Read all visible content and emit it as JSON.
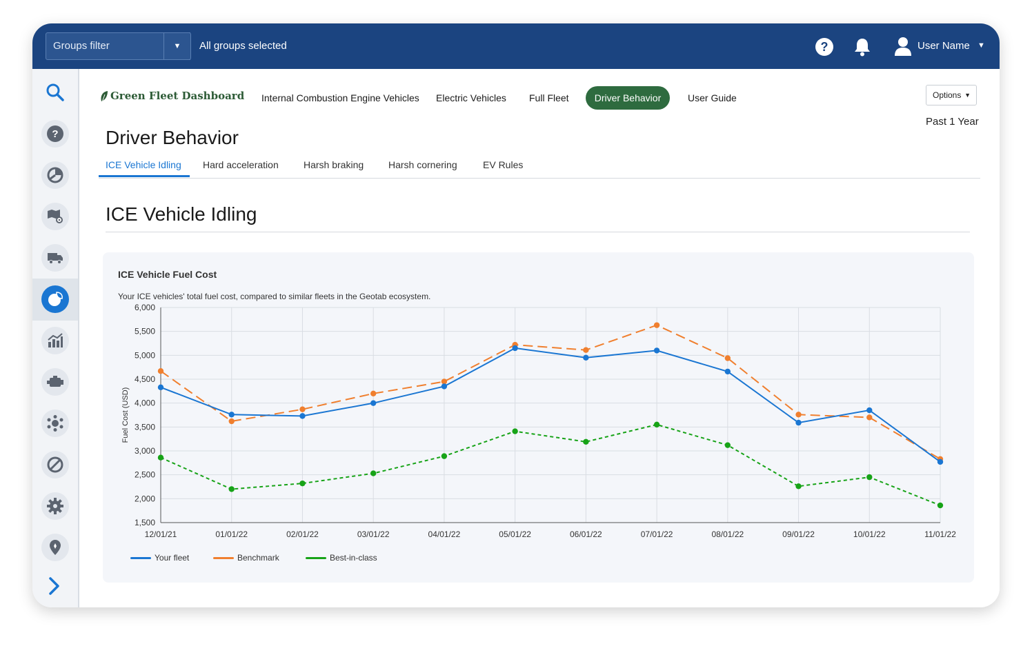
{
  "topbar": {
    "groups_filter_label": "Groups filter",
    "groups_status": "All groups selected",
    "help_label": "?",
    "user_name": "User Name",
    "brand_color": "#1b4480"
  },
  "sidebar": {
    "items": [
      {
        "name": "search-icon"
      },
      {
        "name": "help-icon"
      },
      {
        "name": "pie-chart-icon"
      },
      {
        "name": "map-icon"
      },
      {
        "name": "truck-icon"
      },
      {
        "name": "sustainability-icon",
        "active": true
      },
      {
        "name": "analytics-icon"
      },
      {
        "name": "engine-icon"
      },
      {
        "name": "network-icon"
      },
      {
        "name": "rules-icon"
      },
      {
        "name": "settings-icon"
      },
      {
        "name": "location-icon"
      },
      {
        "name": "expand-icon"
      }
    ]
  },
  "header": {
    "logo_text": "Green Fleet Dashboard",
    "nav": [
      {
        "label": "Internal Combustion Engine Vehicles"
      },
      {
        "label": "Electric Vehicles"
      },
      {
        "label": "Full Fleet"
      },
      {
        "label": "Driver Behavior",
        "active": true
      },
      {
        "label": "User Guide"
      }
    ],
    "options_label": "Options",
    "period": "Past 1 Year",
    "active_color": "#2e6b3f"
  },
  "page": {
    "title": "Driver Behavior",
    "tabs": [
      {
        "label": "ICE Vehicle Idling",
        "active": true
      },
      {
        "label": "Hard acceleration"
      },
      {
        "label": "Harsh braking"
      },
      {
        "label": "Harsh cornering"
      },
      {
        "label": "EV Rules"
      }
    ],
    "section_title": "ICE Vehicle Idling"
  },
  "chart_data": {
    "type": "line",
    "title": "ICE Vehicle Fuel Cost",
    "subtitle": "Your ICE vehicles' total fuel cost, compared to similar fleets in the Geotab ecosystem.",
    "xlabel": "",
    "ylabel": "Fuel Cost (USD)",
    "ylim": [
      1500,
      6000
    ],
    "yticks": [
      1500,
      2000,
      2500,
      3000,
      3500,
      4000,
      4500,
      5000,
      5500,
      6000
    ],
    "ytick_labels": [
      "1,500",
      "2,000",
      "2,500",
      "3,000",
      "3,500",
      "4,000",
      "4,500",
      "5,000",
      "5,500",
      "6,000"
    ],
    "categories": [
      "12/01/21",
      "01/01/22",
      "02/01/22",
      "03/01/22",
      "04/01/22",
      "05/01/22",
      "06/01/22",
      "07/01/22",
      "08/01/22",
      "09/01/22",
      "10/01/22",
      "11/01/22"
    ],
    "grid": true,
    "legend_position": "bottom-left",
    "series": [
      {
        "name": "Your fleet",
        "color": "#1a76d2",
        "style": "solid",
        "values": [
          4330,
          3760,
          3730,
          4000,
          4350,
          5150,
          4950,
          5100,
          4660,
          3590,
          3850,
          2770
        ]
      },
      {
        "name": "Benchmark",
        "color": "#f07f2e",
        "style": "dashed",
        "values": [
          4670,
          3620,
          3870,
          4200,
          4450,
          5220,
          5110,
          5630,
          4940,
          3760,
          3700,
          2830
        ]
      },
      {
        "name": "Best-in-class",
        "color": "#17a317",
        "style": "dotted",
        "values": [
          2860,
          2200,
          2320,
          2530,
          2890,
          3410,
          3190,
          3550,
          3120,
          2260,
          2450,
          1860
        ]
      }
    ]
  }
}
